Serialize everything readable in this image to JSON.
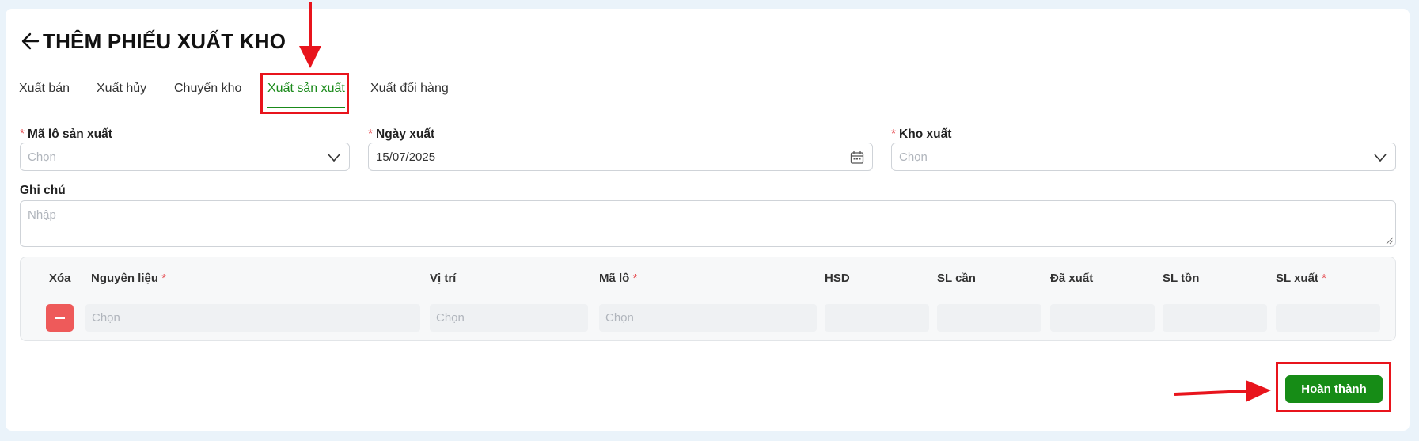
{
  "page": {
    "title": "THÊM PHIẾU XUẤT KHO"
  },
  "tabs": [
    {
      "label": "Xuất bán",
      "active": false
    },
    {
      "label": "Xuất hủy",
      "active": false
    },
    {
      "label": "Chuyển kho",
      "active": false
    },
    {
      "label": "Xuất sản xuất",
      "active": true
    },
    {
      "label": "Xuất đổi hàng",
      "active": false
    }
  ],
  "form": {
    "batch_code": {
      "label": "Mã lô sản xuất",
      "required": "*",
      "placeholder": "Chọn"
    },
    "export_date": {
      "label": "Ngày xuất",
      "required": "*",
      "value": "15/07/2025"
    },
    "warehouse": {
      "label": "Kho xuất",
      "required": "*",
      "placeholder": "Chọn"
    },
    "note": {
      "label": "Ghi chú",
      "placeholder": "Nhập"
    }
  },
  "table": {
    "columns": [
      {
        "label": "Xóa",
        "required": ""
      },
      {
        "label": "Nguyên liệu",
        "required": "*"
      },
      {
        "label": "Vị trí",
        "required": ""
      },
      {
        "label": "Mã lô",
        "required": "*"
      },
      {
        "label": "HSD",
        "required": ""
      },
      {
        "label": "SL cần",
        "required": ""
      },
      {
        "label": "Đã xuất",
        "required": ""
      },
      {
        "label": "SL tồn",
        "required": ""
      },
      {
        "label": "SL xuất",
        "required": "*"
      }
    ],
    "row": {
      "material_placeholder": "Chọn",
      "location_placeholder": "Chọn",
      "batch_placeholder": "Chọn"
    }
  },
  "actions": {
    "complete_label": "Hoàn thành"
  },
  "colors": {
    "accent": "#1a8a1a",
    "button_primary": "#168c16",
    "danger": "#ee5a5a",
    "annotation": "#e8141c"
  }
}
